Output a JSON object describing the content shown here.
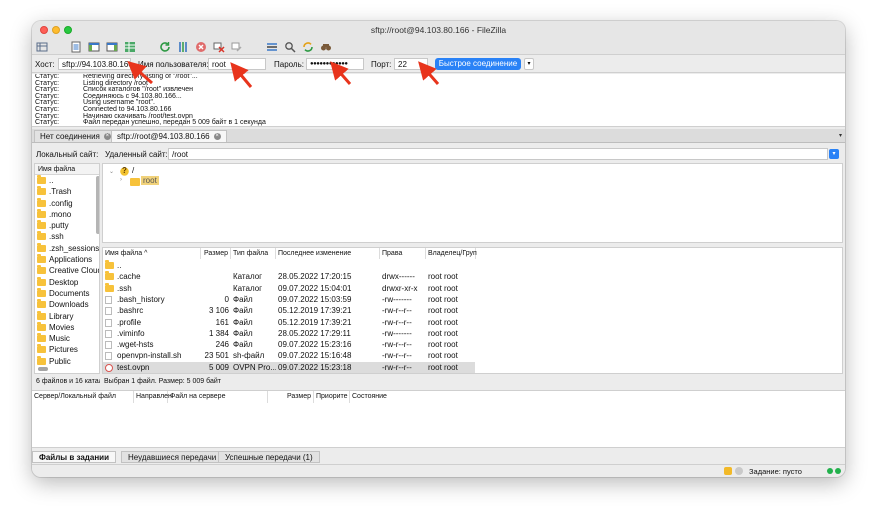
{
  "window": {
    "title": "sftp://root@94.103.80.166 - FileZilla"
  },
  "toolbar": {
    "icons": [
      "site-manager-icon",
      "toggle-log-icon",
      "toggle-local-tree-icon",
      "toggle-remote-tree-icon",
      "toggle-queue-icon",
      "refresh-icon",
      "process-queue-icon",
      "cancel-icon",
      "disconnect-icon",
      "reconnect-icon",
      "filter-icon",
      "compare-icon",
      "sync-browse-icon",
      "search-icon"
    ]
  },
  "quickconnect": {
    "host_label": "Хост:",
    "host_value": "sftp://94.103.80.166",
    "user_label": "Имя пользователя:",
    "user_value": "root",
    "password_label": "Пароль:",
    "password_value": "●●●●●●●●●●●●",
    "port_label": "Порт:",
    "port_value": "22",
    "connect_button": "Быстрое соединение",
    "dropdown": "▾"
  },
  "log": [
    {
      "label": "Статус:",
      "message": "Retrieving directory listing of \"/root\"..."
    },
    {
      "label": "Статус:",
      "message": "Listing directory /root"
    },
    {
      "label": "Статус:",
      "message": "Список каталогов \"/root\" извлечен"
    },
    {
      "label": "Статус:",
      "message": "Соединяюсь с 94.103.80.166..."
    },
    {
      "label": "Статус:",
      "message": "Using username \"root\"."
    },
    {
      "label": "Статус:",
      "message": "Connected to 94.103.80.166"
    },
    {
      "label": "Статус:",
      "message": "Начинаю скачивать /root/test.ovpn"
    },
    {
      "label": "Статус:",
      "message": "Файл передан успешно, передан 5 009 байт в 1 секунда"
    }
  ],
  "tabs": [
    {
      "label": "Нет соединения",
      "close": "×"
    },
    {
      "label": "sftp://root@94.103.80.166",
      "close": "×"
    }
  ],
  "tabs_dropdown": "▾",
  "local_site": {
    "label": "Локальный сайт:",
    "value": ""
  },
  "remote_site": {
    "label": "Удаленный сайт:",
    "value": "/root",
    "dropdown": "▾"
  },
  "local_list": {
    "header": "Имя файла",
    "items": [
      "..",
      ".Trash",
      ".config",
      ".mono",
      ".putty",
      ".ssh",
      ".zsh_sessions",
      "Applications",
      "Creative Cloud",
      "Desktop",
      "Documents",
      "Downloads",
      "Library",
      "Movies",
      "Music",
      "Pictures",
      "Public"
    ],
    "status": "6 файлов и 16 каталогов"
  },
  "remote_tree": {
    "root": "/",
    "child": "root",
    "unknown": "?"
  },
  "remote_list": {
    "headers": {
      "name": "Имя файла",
      "sort": "^",
      "size": "Размер",
      "type": "Тип файла",
      "modified": "Последнее изменение",
      "perms": "Права",
      "owner": "Владелец/Груп"
    },
    "rows": [
      {
        "name": "..",
        "size": "",
        "type": "",
        "modified": "",
        "perms": "",
        "owner": "",
        "icon": "folder"
      },
      {
        "name": ".cache",
        "size": "",
        "type": "Каталог",
        "modified": "28.05.2022 17:20:15",
        "perms": "drwx------",
        "owner": "root root",
        "icon": "folder"
      },
      {
        "name": ".ssh",
        "size": "",
        "type": "Каталог",
        "modified": "09.07.2022 15:04:01",
        "perms": "drwxr-xr-x",
        "owner": "root root",
        "icon": "folder"
      },
      {
        "name": ".bash_history",
        "size": "0",
        "type": "Файл",
        "modified": "09.07.2022 15:03:59",
        "perms": "-rw-------",
        "owner": "root root",
        "icon": "file"
      },
      {
        "name": ".bashrc",
        "size": "3 106",
        "type": "Файл",
        "modified": "05.12.2019 17:39:21",
        "perms": "-rw-r--r--",
        "owner": "root root",
        "icon": "file"
      },
      {
        "name": ".profile",
        "size": "161",
        "type": "Файл",
        "modified": "05.12.2019 17:39:21",
        "perms": "-rw-r--r--",
        "owner": "root root",
        "icon": "file"
      },
      {
        "name": ".viminfo",
        "size": "1 384",
        "type": "Файл",
        "modified": "28.05.2022 17:29:11",
        "perms": "-rw-------",
        "owner": "root root",
        "icon": "file"
      },
      {
        "name": ".wget-hsts",
        "size": "246",
        "type": "Файл",
        "modified": "09.07.2022 15:23:16",
        "perms": "-rw-r--r--",
        "owner": "root root",
        "icon": "file"
      },
      {
        "name": "openvpn-install.sh",
        "size": "23 501",
        "type": "sh-файл",
        "modified": "09.07.2022 15:16:48",
        "perms": "-rw-r--r--",
        "owner": "root root",
        "icon": "file"
      },
      {
        "name": "test.ovpn",
        "size": "5 009",
        "type": "OVPN Pro...",
        "modified": "09.07.2022 15:23:18",
        "perms": "-rw-r--r--",
        "owner": "root root",
        "icon": "cert"
      }
    ],
    "status": "Выбран 1 файл. Размер: 5 009 байт"
  },
  "queue": {
    "headers": [
      "Сервер/Локальный файл",
      "Направлен",
      "Файл на сервере",
      "Размер",
      "Приорите",
      "Состояние"
    ]
  },
  "queue_tabs": [
    "Файлы в задании",
    "Неудавшиеся передачи",
    "Успешные передачи (1)"
  ],
  "statusbar": {
    "queue_label": "Задание: пусто"
  },
  "colors": {
    "accent": "#2a82f6",
    "arrow": "#e8341c",
    "folder": "#f7c23b",
    "led_green": "#22b14c"
  }
}
